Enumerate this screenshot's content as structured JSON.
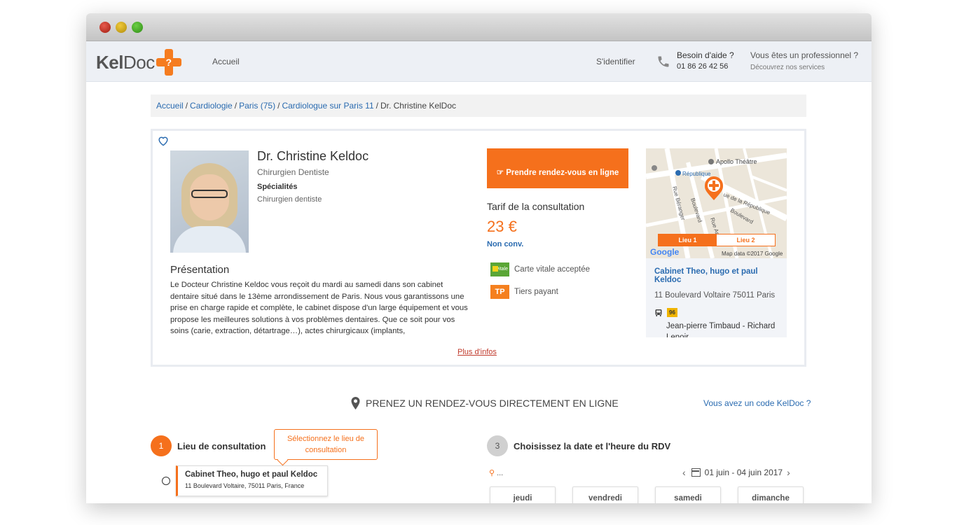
{
  "header": {
    "logo_left": "Kel",
    "logo_right": "Doc",
    "nav_home": "Accueil",
    "login": "S'identifier",
    "help_title": "Besoin d'aide ?",
    "help_phone": "01 86 26 42 56",
    "pro_title": "Vous êtes un professionnel ?",
    "pro_sub": "Découvrez nos services"
  },
  "breadcrumb": {
    "items": [
      "Accueil",
      "Cardiologie",
      "Paris (75)",
      "Cardiologue sur Paris 11"
    ],
    "current": "Dr. Christine KelDoc"
  },
  "doctor": {
    "name": "Dr. Christine Keldoc",
    "title": "Chirurgien Dentiste",
    "spec_label": "Spécialités",
    "spec_value": "Chirurgien dentiste",
    "presentation_title": "Présentation",
    "presentation_text": "Le Docteur Christine Keldoc vous reçoit du mardi au samedi dans son cabinet dentaire situé dans le 13ème arrondissement de Paris. Nous vous garantissons une prise en charge rapide et complète, le cabinet dispose d'un large équipement et vous propose les meilleures solutions à vos problèmes dentaires. Que ce soit pour vos soins (carie, extraction, détartrage…), actes chirurgicaux (implants,",
    "more_link": "Plus d'infos"
  },
  "booking": {
    "cta": "Prendre rendez-vous en ligne",
    "tarif_title": "Tarif de la consultation",
    "price": "23 €",
    "conv": "Non conv.",
    "vitale_icon_text": "vitale",
    "vitale": "Carte vitale acceptée",
    "tp_icon": "TP",
    "tiers": "Tiers payant"
  },
  "map": {
    "label_apollo": "Apollo Théâtre",
    "label_republique": "République",
    "label_rue_rep": "ue de la République",
    "label_rue_ber": "Rue Béranger",
    "label_bd": "Boulevard",
    "label_rue_am": "Rue Am",
    "label_bv": "Boulevard",
    "tab1": "Lieu 1",
    "tab2": "Lieu 2",
    "google": "Google",
    "mapdata": "Map data ©2017 Google",
    "cabinet_name": "Cabinet Theo, hugo et paul Keldoc",
    "cabinet_street": "11 Boulevard Voltaire 75011 Paris",
    "bus_number": "96",
    "stop": "Jean-pierre Timbaud - Richard Lenoir"
  },
  "rdv": {
    "title": "PRENEZ UN RENDEZ-VOUS DIRECTEMENT EN LIGNE",
    "code_link": "Vous avez un code KelDoc ?",
    "step1_num": "1",
    "step1_label": "Lieu de consultation",
    "tooltip": "Sélectionnez le lieu de consultation",
    "loc_name": "Cabinet Theo, hugo et paul Keldoc",
    "loc_addr": "11 Boulevard Voltaire, 75011 Paris, France",
    "step3_num": "3",
    "step3_label": "Choisissez la date et l'heure du RDV",
    "location_placeholder": "...",
    "date_range": "01 juin - 04 juin 2017",
    "days": [
      "jeudi",
      "vendredi",
      "samedi",
      "dimanche"
    ]
  },
  "colors": {
    "accent": "#f5701c",
    "link": "#2a6bb0",
    "header_bg": "#edf0f5"
  }
}
